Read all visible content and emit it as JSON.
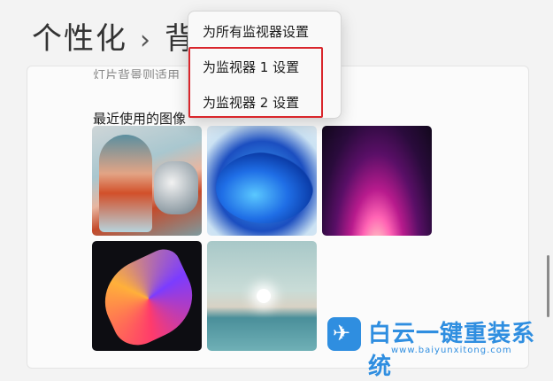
{
  "header": {
    "breadcrumb_parent": "个性化",
    "breadcrumb_separator": "›",
    "breadcrumb_current_fragment": "背"
  },
  "card": {
    "cut_text": "灯片背景则适用",
    "section_title": "最近使用的图像"
  },
  "menu": {
    "items": [
      {
        "label": "为所有监视器设置"
      },
      {
        "label": "为监视器 1 设置"
      },
      {
        "label": "为监视器 2 设置"
      }
    ]
  },
  "watermark": {
    "text": "白云一键重装系统",
    "url": "www.baiyunxitong.com"
  },
  "colors": {
    "highlight": "#d9262c",
    "accent": "#2f8ee0"
  }
}
